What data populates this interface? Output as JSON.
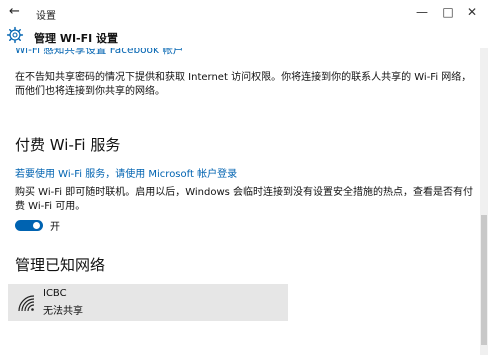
{
  "titlebar": {
    "back_glyph": "←",
    "app_title": "设置",
    "minimize_glyph": "—",
    "maximize_glyph": "□",
    "close_glyph": "✕"
  },
  "header": {
    "page_title": "管理 WI-FI 设置"
  },
  "content": {
    "clipped_link": "Wi-Fi 感知共享设置 Facebook 帐户",
    "share_description": "在不告知共享密码的情况下提供和获取 Internet 访问权限。你将连接到你的联系人共享的 Wi-Fi 网络，而他们也将连接到你共享的网络。",
    "paid_heading": "付费 Wi-Fi 服务",
    "paid_link": "若要使用 Wi-Fi 服务，请使用 Microsoft 帐户登录",
    "paid_description": "购买 Wi-Fi 即可随时联机。启用以后，Windows 会临时连接到没有设置安全措施的热点，查看是否有付费 Wi-Fi 可用。",
    "toggle_label": "开",
    "toggle_on": true,
    "known_heading": "管理已知网络",
    "networks": [
      {
        "name": "ICBC",
        "status": "无法共享"
      }
    ]
  },
  "colors": {
    "accent": "#0063b1",
    "tile": "#e6e6e6"
  }
}
